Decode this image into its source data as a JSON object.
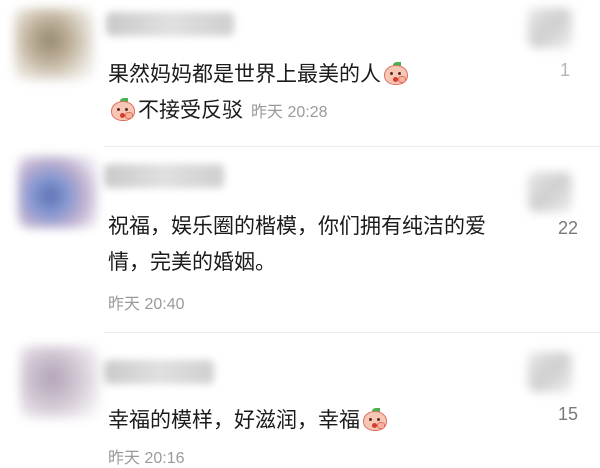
{
  "comments": [
    {
      "text_line1": "果然妈妈都是世界上最美的人",
      "text_line2": "不接受反驳",
      "time": "昨天 20:28",
      "likes": "1"
    },
    {
      "text": "祝福，娱乐圈的楷模，你们拥有纯洁的爱情，完美的婚姻。",
      "time": "昨天 20:40",
      "likes": "22"
    },
    {
      "text": "幸福的模样，好滋润，幸福",
      "time": "昨天 20:16",
      "likes": "15"
    }
  ],
  "icons": {
    "reaction_emoji": "peach-face-emoji-icon",
    "like": "thumbs-up-icon"
  }
}
